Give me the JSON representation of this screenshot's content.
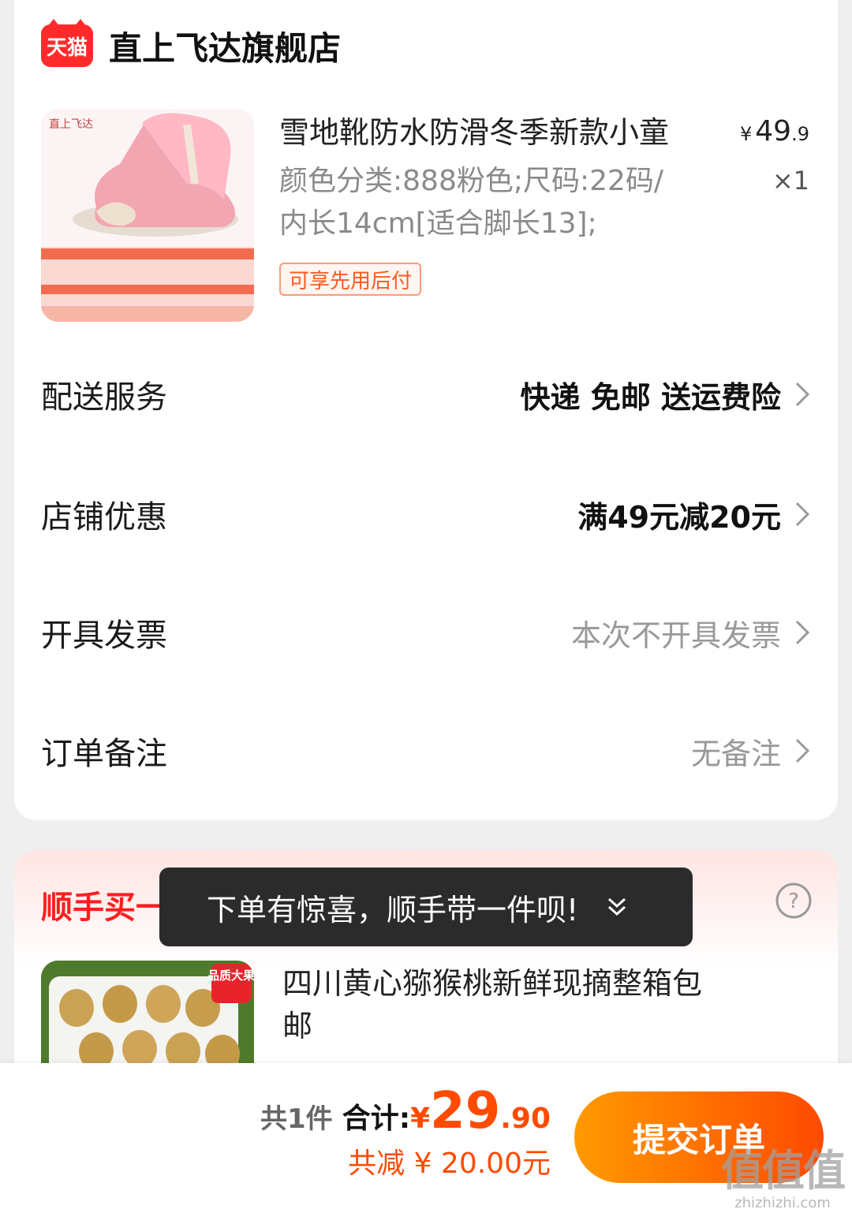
{
  "store": {
    "badge": "天猫",
    "name": "直上飞达旗舰店"
  },
  "product": {
    "image_brand": "直上飞达",
    "title": "雪地靴防水防滑冬季新款小童",
    "spec": "颜色分类:888粉色;尺码:22码/内长14cm[适合脚长13];",
    "price_symbol": "¥",
    "price_int": "49",
    "price_dec": ".9",
    "quantity": "×1",
    "pay_later": "可享先用后付"
  },
  "rows": {
    "delivery": {
      "label": "配送服务",
      "value": "快递 免邮 送运费险"
    },
    "discount": {
      "label": "店铺优惠",
      "value": "满49元减20元"
    },
    "invoice": {
      "label": "开具发票",
      "value": "本次不开具发票"
    },
    "remark": {
      "label": "订单备注",
      "value": "无备注"
    }
  },
  "recommend": {
    "section_title": "顺手买一",
    "toast": "下单有惊喜，顺手带一件呗!",
    "item_badge": "品质大果",
    "item_title": "四川黄心猕猴桃新鲜现摘整箱包邮"
  },
  "footer": {
    "count": "共1件",
    "total_label": "合计:",
    "total_symbol": "¥",
    "total_int": "29",
    "total_dec": ".90",
    "discount_text": "共减 ¥ 20.00元",
    "submit": "提交订单"
  },
  "watermark": {
    "big": "值值值",
    "small": "zhizhizhi.com"
  },
  "colors": {
    "accent": "#ff4b00",
    "tmall_red": "#ff2b2b",
    "section_red": "#ff1e1e"
  }
}
